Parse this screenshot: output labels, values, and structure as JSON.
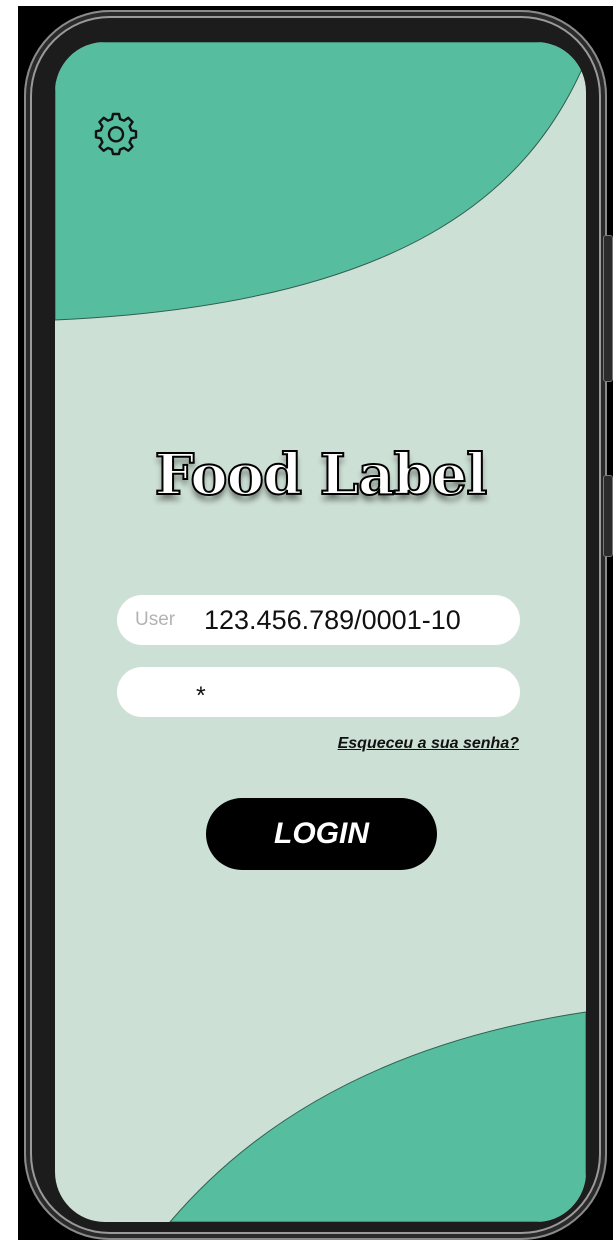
{
  "app": {
    "title": "Food Label"
  },
  "settings": {
    "icon": "gear-icon"
  },
  "login_form": {
    "user_label": "User",
    "user_value": "123.456.789/0001-10",
    "password_value": "*",
    "forgot_password": "Esqueceu a sua senha?",
    "login_button": "LOGIN"
  },
  "colors": {
    "background": "#cde0d5",
    "accent": "#57bd9f",
    "button": "#000000",
    "field": "#ffffff"
  }
}
